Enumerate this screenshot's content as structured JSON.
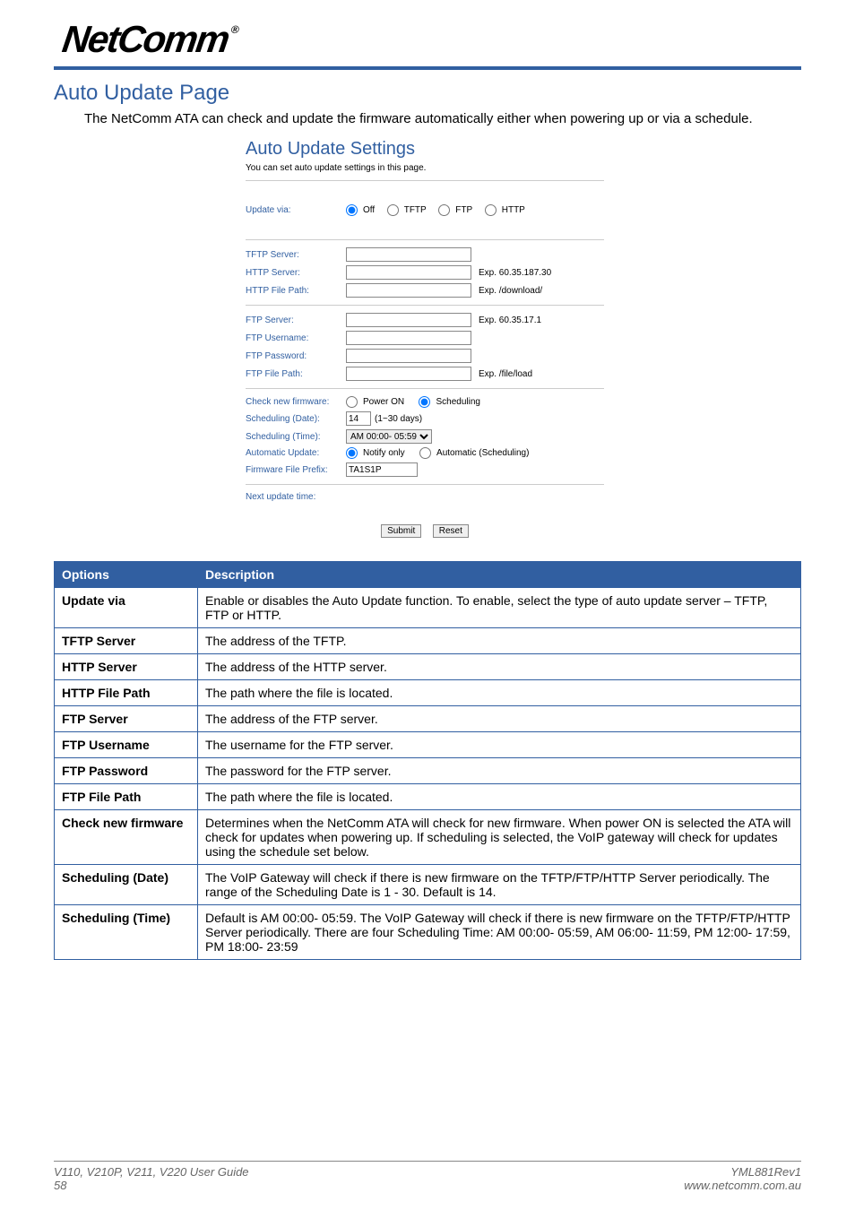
{
  "logo": "NetComm",
  "section_title": "Auto Update Page",
  "intro": "The NetComm ATA can check and update the firmware automatically either when powering up or via a schedule.",
  "panel": {
    "title": "Auto Update Settings",
    "sub": "You can set auto update settings in this page.",
    "update_via": {
      "label": "Update via:",
      "opt_off": "Off",
      "opt_tftp": "TFTP",
      "opt_ftp": "FTP",
      "opt_http": "HTTP"
    },
    "tftp_server": {
      "label": "TFTP Server:"
    },
    "http_server": {
      "label": "HTTP Server:",
      "hint": "Exp. 60.35.187.30"
    },
    "http_path": {
      "label": "HTTP File Path:",
      "hint": "Exp. /download/"
    },
    "ftp_server": {
      "label": "FTP Server:",
      "hint": "Exp. 60.35.17.1"
    },
    "ftp_user": {
      "label": "FTP Username:"
    },
    "ftp_pass": {
      "label": "FTP Password:"
    },
    "ftp_path": {
      "label": "FTP File Path:",
      "hint": "Exp. /file/load"
    },
    "check_fw": {
      "label": "Check new firmware:",
      "opt_power": "Power ON",
      "opt_sched": "Scheduling"
    },
    "sched_date": {
      "label": "Scheduling (Date):",
      "value": "14",
      "hint": "(1~30 days)"
    },
    "sched_time": {
      "label": "Scheduling (Time):",
      "value": "AM 00:00- 05:59"
    },
    "auto_update": {
      "label": "Automatic Update:",
      "opt_notify": "Notify only",
      "opt_auto": "Automatic (Scheduling)"
    },
    "fw_prefix": {
      "label": "Firmware File Prefix:",
      "value": "TA1S1P"
    },
    "next_update": {
      "label": "Next update time:"
    },
    "btn_submit": "Submit",
    "btn_reset": "Reset"
  },
  "options_table": {
    "head_options": "Options",
    "head_desc": "Description",
    "rows": [
      {
        "opt": "Update via",
        "desc": "Enable or disables the Auto Update function. To enable, select the type of auto update server – TFTP, FTP or HTTP."
      },
      {
        "opt": "TFTP Server",
        "desc": "The address of the TFTP."
      },
      {
        "opt": "HTTP Server",
        "desc": "The address of the HTTP server."
      },
      {
        "opt": "HTTP File Path",
        "desc": "The path where the file is located."
      },
      {
        "opt": "FTP Server",
        "desc": "The address of the FTP server."
      },
      {
        "opt": "FTP Username",
        "desc": "The username for the FTP server."
      },
      {
        "opt": "FTP Password",
        "desc": "The password for the FTP server."
      },
      {
        "opt": "FTP File Path",
        "desc": "The path where the file is located."
      },
      {
        "opt": "Check new firmware",
        "desc": "Determines when the NetComm ATA will check for new firmware. When power ON is selected the ATA will check for updates when powering up. If scheduling is selected, the VoIP gateway will check for updates using the schedule set below."
      },
      {
        "opt": "Scheduling (Date)",
        "desc": "The VoIP Gateway will check if there is new firmware on the TFTP/FTP/HTTP Server periodically. The range of the Scheduling Date is 1 - 30. Default is 14."
      },
      {
        "opt": "Scheduling (Time)",
        "desc": "Default is AM 00:00- 05:59. The VoIP Gateway will check if there is new firmware on the TFTP/FTP/HTTP Server periodically. There are four Scheduling Time: AM 00:00- 05:59, AM 06:00- 11:59, PM 12:00- 17:59, PM 18:00- 23:59"
      }
    ]
  },
  "footer": {
    "guide": "V110, V210P, V211, V220 User Guide",
    "page": "58",
    "rev": "YML881Rev1",
    "url": "www.netcomm.com.au"
  }
}
